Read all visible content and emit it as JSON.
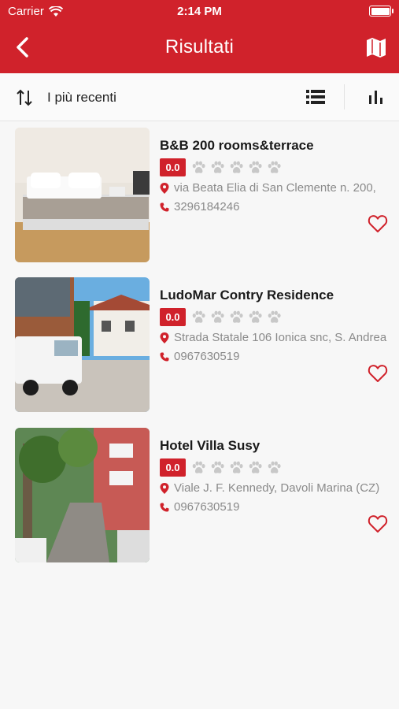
{
  "status": {
    "carrier": "Carrier",
    "time": "2:14 PM"
  },
  "nav": {
    "title": "Risultati"
  },
  "toolbar": {
    "sort_label": "I più recenti"
  },
  "colors": {
    "brand": "#d0222b",
    "paw": "#c8c8c8",
    "text_muted": "#8a8a8a"
  },
  "results": [
    {
      "name": "B&B 200 rooms&terrace",
      "score": "0.0",
      "address": "via Beata Elia di San Clemente n. 200,",
      "phone": "3296184246"
    },
    {
      "name": "LudoMar Contry Residence",
      "score": "0.0",
      "address": "Strada Statale 106 Ionica snc, S. Andrea",
      "phone": "0967630519"
    },
    {
      "name": "Hotel Villa Susy",
      "score": "0.0",
      "address": "Viale J. F. Kennedy, Davoli Marina (CZ)",
      "phone": "0967630519"
    }
  ]
}
